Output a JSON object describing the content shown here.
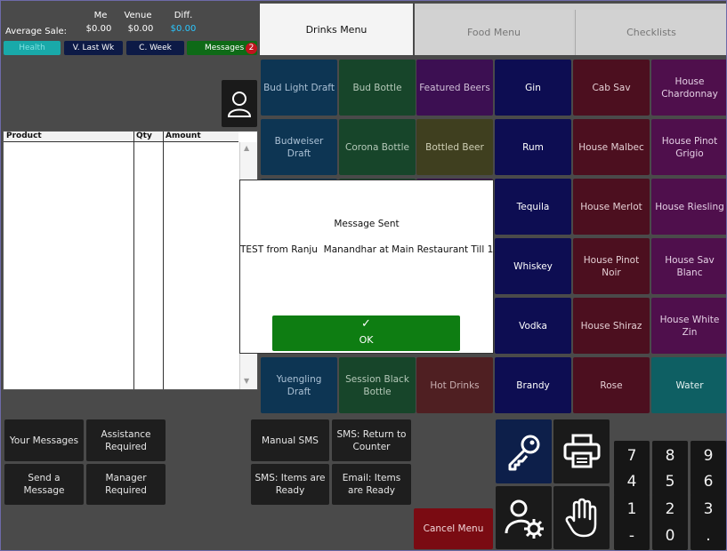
{
  "stats": {
    "avg_label": "Average Sale:",
    "me_header": "Me",
    "venue_header": "Venue",
    "diff_header": "Diff.",
    "me_value": "$0.00",
    "venue_value": "$0.00",
    "diff_value": "$0.00"
  },
  "periods": {
    "today": "Health",
    "last_week": "V. Last Wk",
    "current_week": "C. Week",
    "messages": "Messages",
    "messages_badge": "2"
  },
  "order_table": {
    "headers": [
      "Product",
      "Qty",
      "Amount"
    ]
  },
  "tabs": [
    "Drinks Menu",
    "Food Menu",
    "Checklists"
  ],
  "menu_tiles": [
    {
      "label": "Bud Light Draft",
      "style": "blue"
    },
    {
      "label": "Bud Bottle",
      "style": "green"
    },
    {
      "label": "Featured Beers",
      "style": "purple"
    },
    {
      "label": "Gin",
      "style": "navy"
    },
    {
      "label": "Cab Sav",
      "style": "wine"
    },
    {
      "label": "House Chardonnay",
      "style": "mag"
    },
    {
      "label": "Budweiser Draft",
      "style": "blue"
    },
    {
      "label": "Corona Bottle",
      "style": "green"
    },
    {
      "label": "Bottled Beer",
      "style": "olive"
    },
    {
      "label": "Rum",
      "style": "navy"
    },
    {
      "label": "House Malbec",
      "style": "wine"
    },
    {
      "label": "House Pinot Grigio",
      "style": "mag"
    },
    {
      "label": "Tequila",
      "style": "navy"
    },
    {
      "label": "House Merlot",
      "style": "wine"
    },
    {
      "label": "House Riesling",
      "style": "mag"
    },
    {
      "label": "Whiskey",
      "style": "navy"
    },
    {
      "label": "House Pinot Noir",
      "style": "wine"
    },
    {
      "label": "House Sav Blanc",
      "style": "mag"
    },
    {
      "label": "Vodka",
      "style": "navy"
    },
    {
      "label": "House Shiraz",
      "style": "wine"
    },
    {
      "label": "House White Zin",
      "style": "mag"
    },
    {
      "label": "Yuengling Draft",
      "style": "blue"
    },
    {
      "label": "Session Black Bottle",
      "style": "green"
    },
    {
      "label": "Hot Drinks",
      "style": "rose"
    },
    {
      "label": "Brandy",
      "style": "navy"
    },
    {
      "label": "Rose",
      "style": "wine"
    },
    {
      "label": "Water",
      "style": "teal"
    }
  ],
  "dialog": {
    "title": "Message Sent",
    "body": "TEST from Ranju  Manandhar at Main Restaurant Till 1",
    "ok_check": "✓",
    "ok_label": "OK"
  },
  "bottom_buttons": {
    "your_messages": "Your Messages",
    "assistance_required": "Assistance Required",
    "send_message": "Send a Message",
    "manager_required": "Manager Required",
    "manual_sms": "Manual SMS",
    "sms_return": "SMS: Return to Counter",
    "sms_items_ready": "SMS: Items are Ready",
    "email_items_ready": "Email: Items are Ready",
    "cancel_menu": "Cancel Menu"
  },
  "keypad": [
    "7",
    "8",
    "9",
    "4",
    "5",
    "6",
    "1",
    "2",
    "3",
    "-",
    "0",
    "."
  ],
  "colors": {
    "ok_green": "#0e7d12",
    "badge_red": "#c0141e",
    "cancel_red": "#7a0b12",
    "accent_cyan": "#19a9a9"
  }
}
